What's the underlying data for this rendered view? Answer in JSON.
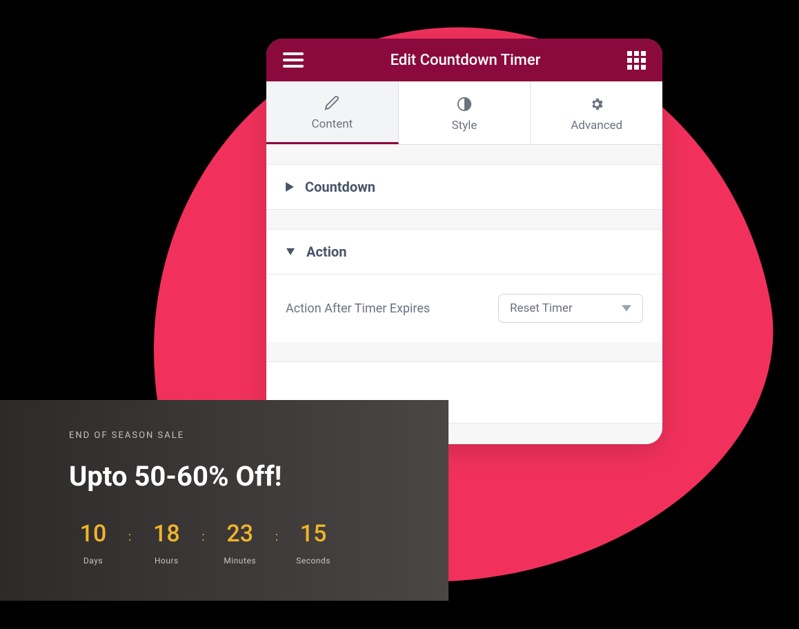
{
  "panel": {
    "title": "Edit Countdown Timer",
    "tabs": {
      "content": "Content",
      "style": "Style",
      "advanced": "Advanced"
    },
    "sections": {
      "countdown": "Countdown",
      "action": "Action"
    },
    "action_field": {
      "label": "Action After Timer Expires",
      "value": "Reset Timer"
    }
  },
  "promo": {
    "eyebrow": "END OF SEASON SALE",
    "headline": "Upto 50-60% Off!",
    "countdown": {
      "days": {
        "value": "10",
        "label": "Days"
      },
      "hours": {
        "value": "18",
        "label": "Hours"
      },
      "minutes": {
        "value": "23",
        "label": "Minutes"
      },
      "seconds": {
        "value": "15",
        "label": "Seconds"
      }
    }
  }
}
